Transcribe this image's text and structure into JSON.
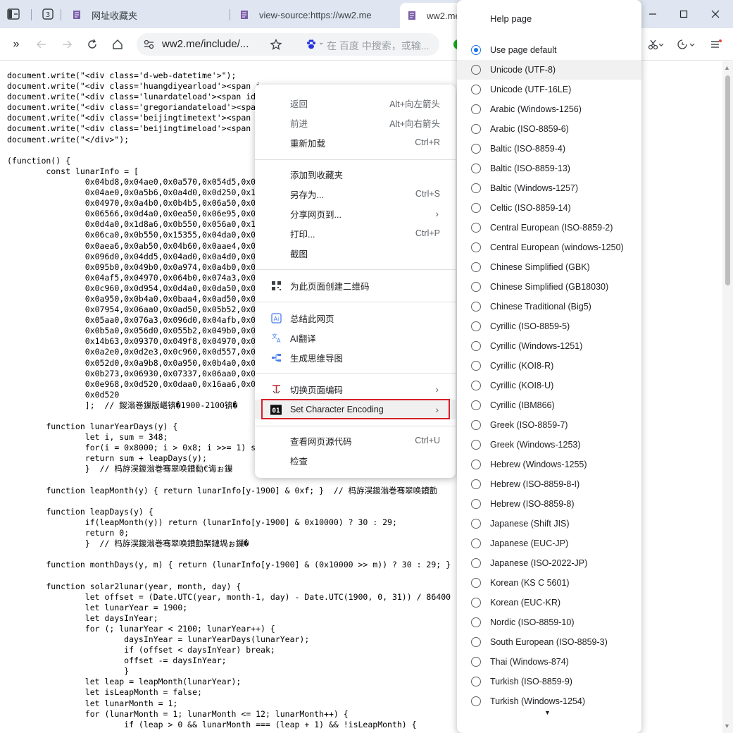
{
  "tabs": [
    {
      "label": "网址收藏夹"
    },
    {
      "label": "view-source:https://ww2.me"
    },
    {
      "label": "ww2.me/"
    }
  ],
  "toolbar": {
    "url": "ww2.me/include/...",
    "search_placeholder": "在 百度 中搜索，或输..."
  },
  "source_lines": [
    "document.write(\"<div class='d-web-datetime'>\");",
    "document.write(\"<div class='huangdiyearload'><span i",
    "document.write(\"<div class='lunardateload'><span id",
    "document.write(\"<div class='gregoriandateload'><spa                                                       </div>\");",
    "document.write(\"<div class='beijingtimetext'><span",
    "document.write(\"<div class='beijingtimeload'><span",
    "document.write(\"</div>\");",
    "",
    "(function() {",
    "        const lunarInfo = [",
    "                0x04bd8,0x04ae0,0x0a570,0x054d5,0x0",
    "                0x04ae0,0x0a5b6,0x0a4d0,0x0d250,0x1",
    "                0x04970,0x0a4b0,0x0b4b5,0x06a50,0x0",
    "                0x06566,0x0d4a0,0x0ea50,0x06e95,0x0",
    "                0x0d4a0,0x1d8a6,0x0b550,0x056a0,0x1",
    "                0x06ca0,0x0b550,0x15355,0x04da0,0x0",
    "                0x0aea6,0x0ab50,0x04b60,0x0aae4,0x0",
    "                0x096d0,0x04dd5,0x04ad0,0x0a4d0,0x0",
    "                0x095b0,0x049b0,0x0a974,0x0a4b0,0x0",
    "                0x04af5,0x04970,0x064b0,0x074a3,0x0",
    "                0x0c960,0x0d954,0x0d4a0,0x0da50,0x0",
    "                0x0a950,0x0b4a0,0x0baa4,0x0ad50,0x0",
    "                0x07954,0x06aa0,0x0ad50,0x05b52,0x0",
    "                0x05aa0,0x076a3,0x096d0,0x04afb,0x0",
    "                0x0b5a0,0x056d0,0x055b2,0x049b0,0x0",
    "                0x14b63,0x09370,0x049f8,0x04970,0x0",
    "                0x0a2e0,0x0d2e3,0x0c960,0x0d557,0x0",
    "                0x052d0,0x0a9b8,0x0a950,0x0b4a0,0x0",
    "                0x0b273,0x06930,0x07337,0x06aa0,0x0",
    "                0x0e968,0x0d520,0x0daa0,0x16aa6,0x0",
    "                0x0d520",
    "                ];  // 鍐滃巻鏁版嵁锛�1900-2100锛�",
    "",
    "        function lunarYearDays(y) {",
    "                let i, sum = 348;",
    "                for(i = 0x8000; i > 0x8; i >>= 1) s",
    "                return sum + leapDays(y);",
    "                }  // 杩斿洖鍐滃巻骞翠唤鐨勬€诲ぉ鏁",
    "",
    "        function leapMonth(y) { return lunarInfo[y-1900] & 0xf; }  // 杩斿洖鍐滃巻骞翠唤鐨勯",
    "",
    "        function leapDays(y) {",
    "                if(leapMonth(y)) return (lunarInfo[y-1900] & 0x10000) ? 30 : 29;",
    "                return 0;",
    "                }  // 杩斿洖鍐滃巻骞翠唤鐨勯棸鏈堝ぉ鏁�",
    "",
    "        function monthDays(y, m) { return (lunarInfo[y-1900] & (0x10000 >> m)) ? 30 : 29; }",
    "",
    "        function solar2lunar(year, month, day) {",
    "                let offset = (Date.UTC(year, month-1, day) - Date.UTC(1900, 0, 31)) / 86400",
    "                let lunarYear = 1900;",
    "                let daysInYear;",
    "                for (; lunarYear < 2100; lunarYear++) {",
    "                        daysInYear = lunarYearDays(lunarYear);",
    "                        if (offset < daysInYear) break;",
    "                        offset -= daysInYear;",
    "                        }",
    "                let leap = leapMonth(lunarYear);",
    "                let isLeapMonth = false;",
    "                let lunarMonth = 1;",
    "                for (lunarMonth = 1; lunarMonth <= 12; lunarMonth++) {",
    "                        if (leap > 0 && lunarMonth === (leap + 1) && !isLeapMonth) {"
  ],
  "context_menu": {
    "items": [
      {
        "label": "返回",
        "shortcut": "Alt+向左箭头"
      },
      {
        "label": "前进",
        "shortcut": "Alt+向右箭头"
      },
      {
        "label": "重新加载",
        "shortcut": "Ctrl+R"
      },
      {
        "label": "添加到收藏夹",
        "shortcut": ""
      },
      {
        "label": "另存为...",
        "shortcut": "Ctrl+S"
      },
      {
        "label": "分享网页到...",
        "shortcut": ""
      },
      {
        "label": "打印...",
        "shortcut": "Ctrl+P"
      },
      {
        "label": "截图",
        "shortcut": ""
      },
      {
        "label": "为此页面创建二维码",
        "shortcut": ""
      },
      {
        "label": "总结此网页",
        "shortcut": ""
      },
      {
        "label": "AI翻译",
        "shortcut": ""
      },
      {
        "label": "生成思维导图",
        "shortcut": ""
      },
      {
        "label": "切换页面编码",
        "shortcut": ""
      },
      {
        "label": "Set Character Encoding",
        "shortcut": ""
      },
      {
        "label": "查看网页源代码",
        "shortcut": "Ctrl+U"
      },
      {
        "label": "检查",
        "shortcut": ""
      }
    ]
  },
  "encoding_menu": {
    "title": "Help page",
    "options": [
      "Use page default",
      "Unicode (UTF-8)",
      "Unicode (UTF-16LE)",
      "Arabic (Windows-1256)",
      "Arabic (ISO-8859-6)",
      "Baltic (ISO-8859-4)",
      "Baltic (ISO-8859-13)",
      "Baltic (Windows-1257)",
      "Celtic (ISO-8859-14)",
      "Central European (ISO-8859-2)",
      "Central European (windows-1250)",
      "Chinese Simplified (GBK)",
      "Chinese Simplified (GB18030)",
      "Chinese Traditional (Big5)",
      "Cyrillic (ISO-8859-5)",
      "Cyrillic (Windows-1251)",
      "Cyrillic (KOI8-R)",
      "Cyrillic (KOI8-U)",
      "Cyrillic (IBM866)",
      "Greek (ISO-8859-7)",
      "Greek (Windows-1253)",
      "Hebrew (Windows-1255)",
      "Hebrew (ISO-8859-8-I)",
      "Hebrew (ISO-8859-8)",
      "Japanese (Shift JIS)",
      "Japanese (EUC-JP)",
      "Japanese (ISO-2022-JP)",
      "Korean (KS C 5601)",
      "Korean (EUC-KR)",
      "Nordic (ISO-8859-10)",
      "South European (ISO-8859-3)",
      "Thai (Windows-874)",
      "Turkish (ISO-8859-9)",
      "Turkish (Windows-1254)"
    ],
    "selected": "Use page default"
  },
  "colors": {
    "tab_strip": "#dfe6f1",
    "highlight_box": "#d6202a",
    "radio_selected": "#1a73e8"
  }
}
